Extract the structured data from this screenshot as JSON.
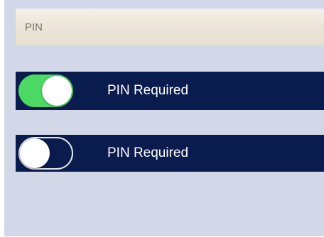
{
  "pin_field": {
    "placeholder": "PIN",
    "value": ""
  },
  "settings": [
    {
      "label": "PIN Required",
      "toggle": "on"
    },
    {
      "label": "PIN Required",
      "toggle": "off"
    }
  ],
  "colors": {
    "screen_background": "#d2d8e8",
    "row_background": "#0a1b4d",
    "toggle_on": "#4cd964",
    "field_background": "#ebe4d6"
  }
}
